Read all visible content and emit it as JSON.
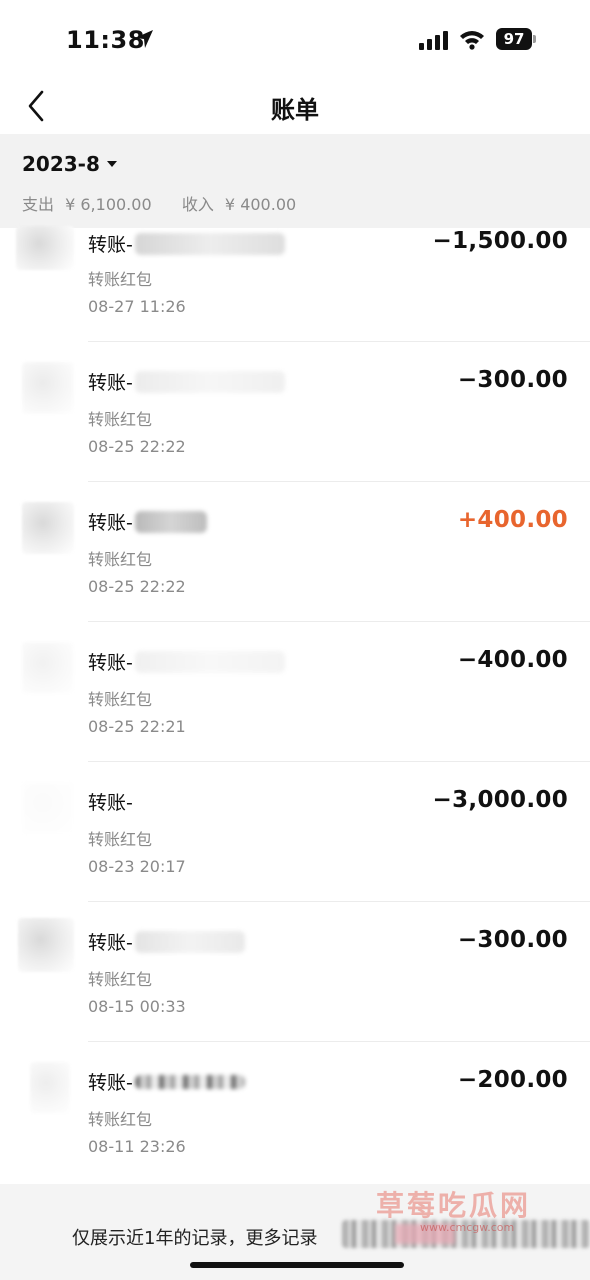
{
  "status_bar": {
    "time": "11:38",
    "battery": "97"
  },
  "nav": {
    "title": "账单"
  },
  "month_header": {
    "month": "2023-8",
    "expense_label": "支出",
    "expense_value": "¥ 6,100.00",
    "income_label": "收入",
    "income_value": "¥ 400.00"
  },
  "transactions": [
    {
      "title": "转账-",
      "category": "转账红包",
      "datetime": "08-27  11:26",
      "amount": "−1,500.00",
      "type": "expense"
    },
    {
      "title": "转账-",
      "category": "转账红包",
      "datetime": "08-25  22:22",
      "amount": "−300.00",
      "type": "expense"
    },
    {
      "title": "转账-",
      "category": "转账红包",
      "datetime": "08-25  22:22",
      "amount": "+400.00",
      "type": "income"
    },
    {
      "title": "转账-",
      "category": "转账红包",
      "datetime": "08-25  22:21",
      "amount": "−400.00",
      "type": "expense"
    },
    {
      "title": "转账-",
      "category": "转账红包",
      "datetime": "08-23  20:17",
      "amount": "−3,000.00",
      "type": "expense"
    },
    {
      "title": "转账-",
      "category": "转账红包",
      "datetime": "08-15  00:33",
      "amount": "−300.00",
      "type": "expense"
    },
    {
      "title": "转账-",
      "category": "转账红包",
      "datetime": "08-11  23:26",
      "amount": "−200.00",
      "type": "expense"
    }
  ],
  "footer": {
    "note": "仅展示近1年的记录，更多记录",
    "watermark": "草莓吃瓜网",
    "watermark_url": "www.cmcgw.com"
  },
  "colors": {
    "income": "#e8652e",
    "expense": "#111111",
    "header_bg": "#f2f2f2"
  },
  "icons": {
    "back": "chevron-left-icon",
    "month_caret": "caret-down-icon",
    "location": "location-arrow-icon",
    "signal": "cellular-signal-icon",
    "wifi": "wifi-icon"
  }
}
